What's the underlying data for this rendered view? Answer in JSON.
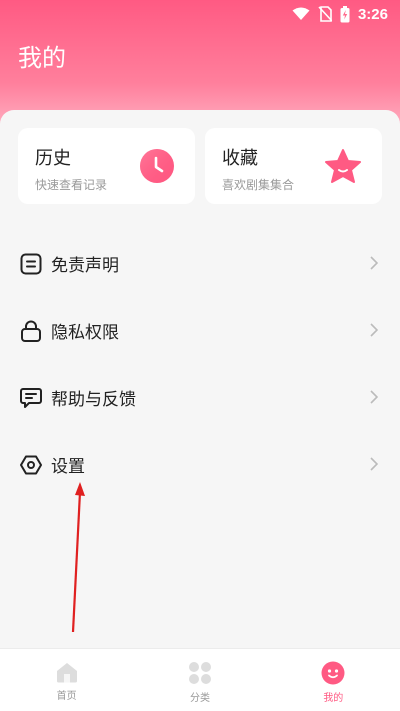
{
  "status_bar": {
    "time": "3:26"
  },
  "page": {
    "title": "我的"
  },
  "quick_cards": [
    {
      "title": "历史",
      "subtitle": "快速查看记录",
      "icon": "clock-icon",
      "accent": "#ff5a83"
    },
    {
      "title": "收藏",
      "subtitle": "喜欢剧集集合",
      "icon": "star-icon",
      "accent": "#ff5a83"
    }
  ],
  "menu": [
    {
      "label": "免责声明",
      "icon": "document-icon"
    },
    {
      "label": "隐私权限",
      "icon": "lock-icon"
    },
    {
      "label": "帮助与反馈",
      "icon": "feedback-icon"
    },
    {
      "label": "设置",
      "icon": "settings-icon"
    }
  ],
  "tabbar": [
    {
      "label": "首页",
      "icon": "home-icon",
      "active": false
    },
    {
      "label": "分类",
      "icon": "grid-icon",
      "active": false
    },
    {
      "label": "我的",
      "icon": "smile-icon",
      "active": true
    }
  ],
  "colors": {
    "accent": "#ff5a83",
    "annotation_arrow": "#e02020"
  }
}
